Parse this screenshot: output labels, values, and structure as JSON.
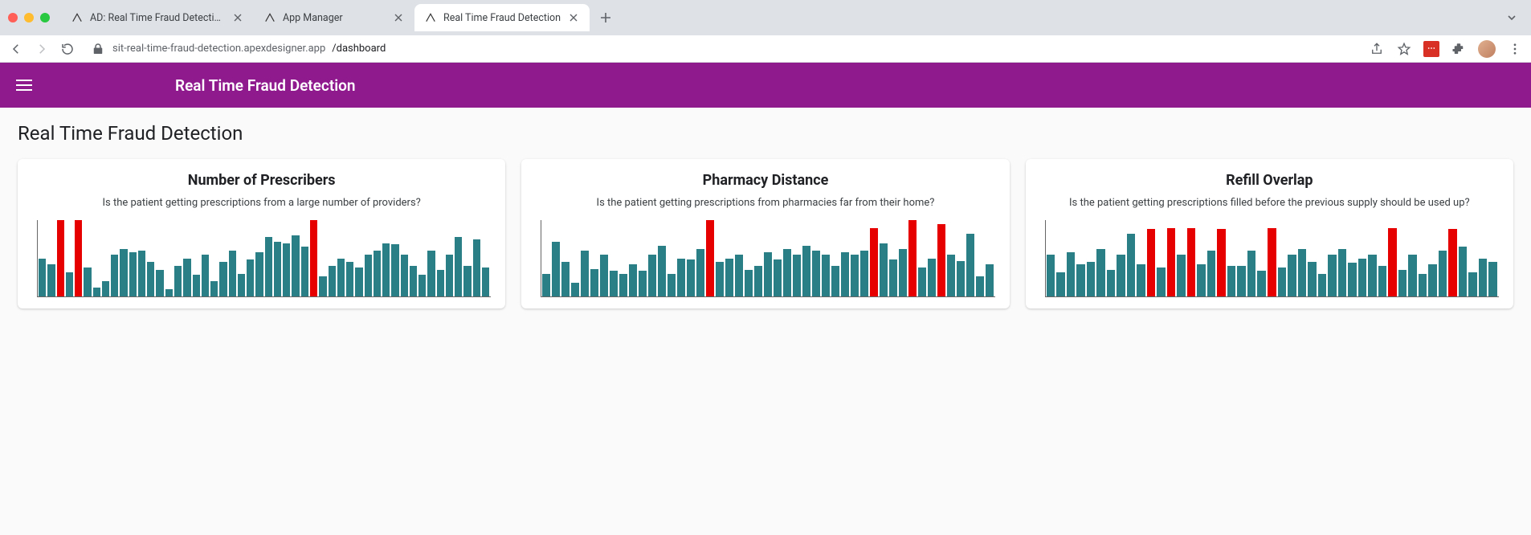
{
  "browser": {
    "tabs": [
      {
        "title": "AD: Real Time Fraud Detection",
        "active": false
      },
      {
        "title": "App Manager",
        "active": false
      },
      {
        "title": "Real Time Fraud Detection",
        "active": true
      }
    ],
    "url_host": "sit-real-time-fraud-detection.apexdesigner.app",
    "url_path": "/dashboard"
  },
  "app": {
    "title": "Real Time Fraud Detection",
    "accent_color": "#8e1a8e"
  },
  "page": {
    "title": "Real Time Fraud Detection"
  },
  "cards": [
    {
      "title": "Number of Prescribers",
      "subtitle": "Is the patient getting prescriptions from a large number of providers?"
    },
    {
      "title": "Pharmacy Distance",
      "subtitle": "Is the patient getting prescriptions from pharmacies far from their home?"
    },
    {
      "title": "Refill Overlap",
      "subtitle": "Is the patient getting prescriptions filled before the previous supply should be used up?"
    }
  ],
  "chart_data": [
    {
      "type": "bar",
      "title": "Number of Prescribers",
      "ylim": [
        0,
        100
      ],
      "normal_color": "#2a7f86",
      "anomaly_color": "#e60000",
      "values": [
        50,
        42,
        100,
        32,
        100,
        38,
        12,
        20,
        55,
        62,
        58,
        60,
        45,
        35,
        10,
        40,
        50,
        28,
        55,
        20,
        45,
        60,
        30,
        48,
        58,
        78,
        72,
        70,
        80,
        65,
        100,
        26,
        40,
        50,
        45,
        38,
        55,
        60,
        70,
        68,
        55,
        40,
        28,
        60,
        35,
        55,
        78,
        40,
        75,
        38
      ],
      "anomalies": [
        0,
        0,
        1,
        0,
        1,
        0,
        0,
        0,
        0,
        0,
        0,
        0,
        0,
        0,
        0,
        0,
        0,
        0,
        0,
        0,
        0,
        0,
        0,
        0,
        0,
        0,
        0,
        0,
        0,
        0,
        1,
        0,
        0,
        0,
        0,
        0,
        0,
        0,
        0,
        0,
        0,
        0,
        0,
        0,
        0,
        0,
        0,
        0,
        0,
        0
      ]
    },
    {
      "type": "bar",
      "title": "Pharmacy Distance",
      "ylim": [
        0,
        100
      ],
      "normal_color": "#2a7f86",
      "anomaly_color": "#e60000",
      "values": [
        30,
        72,
        45,
        18,
        60,
        36,
        55,
        34,
        30,
        42,
        34,
        55,
        66,
        30,
        50,
        48,
        62,
        100,
        45,
        50,
        55,
        35,
        40,
        58,
        48,
        62,
        55,
        66,
        60,
        55,
        40,
        58,
        55,
        60,
        90,
        70,
        48,
        62,
        100,
        38,
        50,
        95,
        55,
        46,
        82,
        26,
        42
      ],
      "anomalies": [
        0,
        0,
        0,
        0,
        0,
        0,
        0,
        0,
        0,
        0,
        0,
        0,
        0,
        0,
        0,
        0,
        0,
        1,
        0,
        0,
        0,
        0,
        0,
        0,
        0,
        0,
        0,
        0,
        0,
        0,
        0,
        0,
        0,
        0,
        1,
        0,
        0,
        0,
        1,
        0,
        0,
        1,
        0,
        0,
        0,
        0,
        0
      ]
    },
    {
      "type": "bar",
      "title": "Refill Overlap",
      "ylim": [
        0,
        100
      ],
      "normal_color": "#2a7f86",
      "anomaly_color": "#e60000",
      "values": [
        55,
        32,
        58,
        42,
        45,
        62,
        35,
        55,
        82,
        42,
        88,
        38,
        90,
        55,
        90,
        42,
        60,
        88,
        40,
        40,
        60,
        34,
        90,
        38,
        55,
        62,
        45,
        30,
        55,
        62,
        44,
        50,
        55,
        40,
        90,
        35,
        55,
        30,
        42,
        60,
        88,
        65,
        32,
        50,
        45
      ],
      "anomalies": [
        0,
        0,
        0,
        0,
        0,
        0,
        0,
        0,
        0,
        0,
        1,
        0,
        1,
        0,
        1,
        0,
        0,
        1,
        0,
        0,
        0,
        0,
        1,
        0,
        0,
        0,
        0,
        0,
        0,
        0,
        0,
        0,
        0,
        0,
        1,
        0,
        0,
        0,
        0,
        0,
        1,
        0,
        0,
        0,
        0
      ]
    }
  ]
}
